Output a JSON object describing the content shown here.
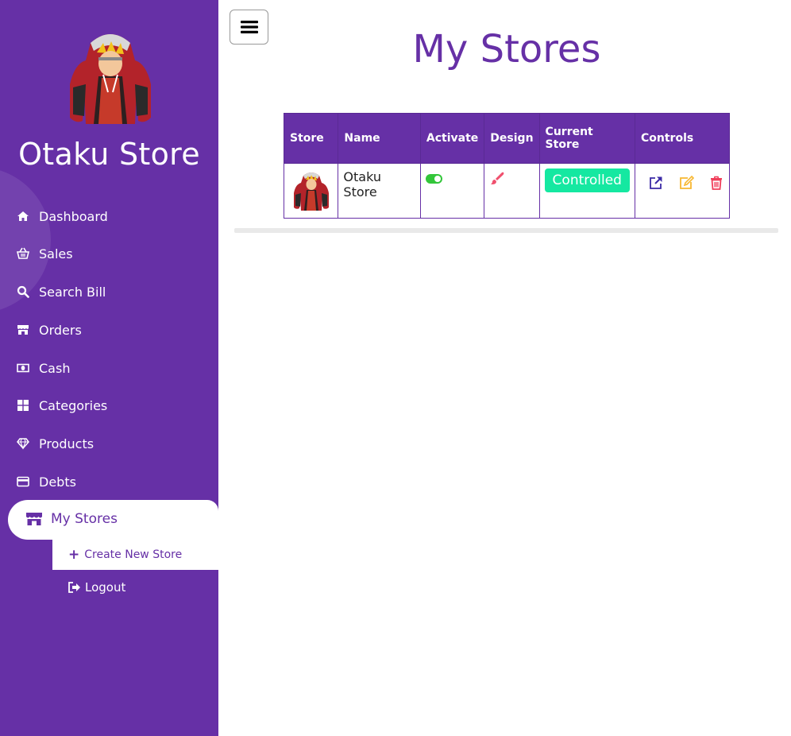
{
  "sidebar": {
    "brand": "Otaku Store",
    "items": [
      {
        "label": "Dashboard",
        "icon": "home-icon"
      },
      {
        "label": "Sales",
        "icon": "basket-icon"
      },
      {
        "label": "Search Bill",
        "icon": "search-icon"
      },
      {
        "label": "Orders",
        "icon": "store-icon"
      },
      {
        "label": "Cash",
        "icon": "money-icon"
      },
      {
        "label": "Categories",
        "icon": "grid-icon"
      },
      {
        "label": "Products",
        "icon": "diamond-icon"
      },
      {
        "label": "Debts",
        "icon": "credit-card-icon"
      }
    ],
    "active_item": {
      "label": "My Stores",
      "icon": "store-icon"
    },
    "submenu": {
      "label": "Create New Store",
      "icon": "plus-icon"
    },
    "logout": {
      "label": "Logout",
      "icon": "sign-out-icon"
    }
  },
  "main": {
    "title": "My Stores",
    "table": {
      "headers": [
        "Store",
        "Name",
        "Activate",
        "Design",
        "Current Store",
        "Controls"
      ],
      "rows": [
        {
          "name": "Otaku Store",
          "activated": true,
          "current_store": "Controlled"
        }
      ]
    }
  },
  "colors": {
    "primary": "#6630a6",
    "accent_green": "#15e8a1",
    "toggle_green": "#33c63a",
    "design_pink": "#f0506e",
    "edit_yellow": "#f7b731",
    "delete_red": "#f03e5a",
    "open_blue": "#3b2aa6"
  }
}
